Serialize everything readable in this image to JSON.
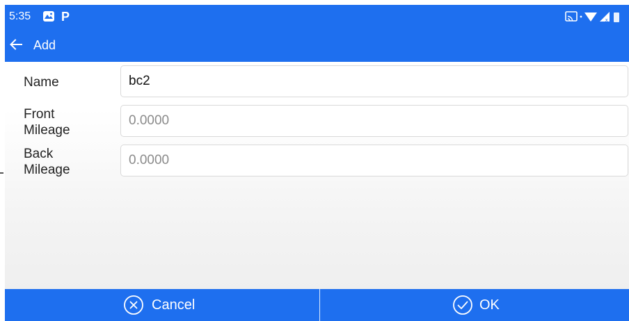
{
  "status_bar": {
    "time": "5:35",
    "notification_icon_1": "gallery-icon",
    "notification_icon_2": "P",
    "right_icons": [
      "cast-icon",
      "wifi-icon",
      "signal-icon",
      "battery-icon"
    ]
  },
  "toolbar": {
    "title": "Add",
    "back_icon": "arrow-left-icon"
  },
  "form": {
    "name": {
      "label": "Name",
      "value": "bc2",
      "placeholder": ""
    },
    "front_mileage": {
      "label_line1": "Front",
      "label_line2": "Mileage",
      "value": "",
      "placeholder": "0.0000"
    },
    "back_mileage": {
      "label_line1": "Back",
      "label_line2": "Mileage",
      "value": "",
      "placeholder": "0.0000"
    }
  },
  "actions": {
    "cancel_label": "Cancel",
    "cancel_icon": "circle-x-icon",
    "ok_label": "OK",
    "ok_icon": "circle-check-icon"
  },
  "colors": {
    "primary": "#1e6fef",
    "label_text": "#222222",
    "placeholder_text": "#8a8a8a"
  }
}
